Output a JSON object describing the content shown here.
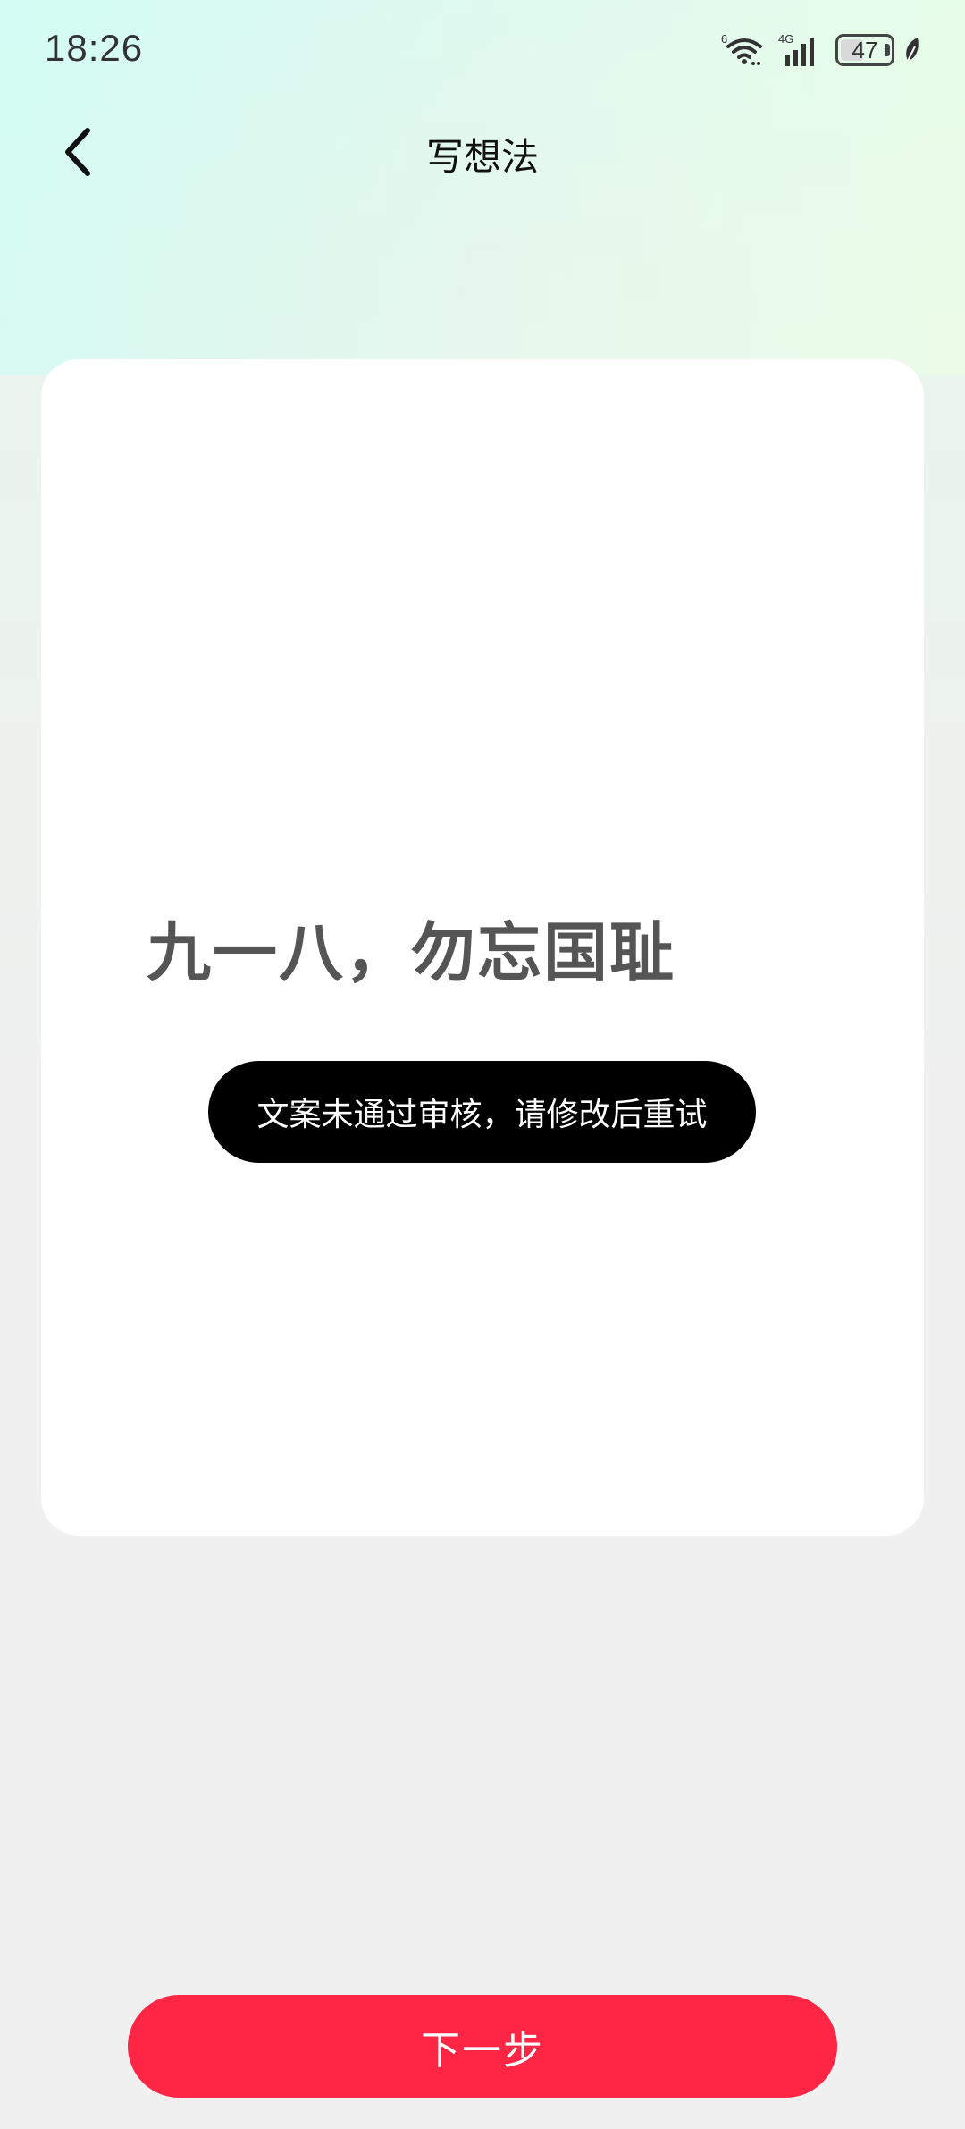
{
  "status_bar": {
    "time": "18:26",
    "wifi_label": "6",
    "network_label": "4G",
    "battery_level": "47",
    "icons": [
      "wifi-icon",
      "cellular-signal-icon",
      "battery-icon",
      "leaf-icon"
    ]
  },
  "header": {
    "title": "写想法",
    "back_icon": "chevron-left-icon"
  },
  "card": {
    "content_text": "九一八，勿忘国耻"
  },
  "toast": {
    "message": "文案未通过审核，请修改后重试"
  },
  "footer": {
    "next_label": "下一步"
  },
  "colors": {
    "accent": "#fe2545",
    "toast_bg": "#000000",
    "card_bg": "#ffffff",
    "content_text": "#555555"
  }
}
